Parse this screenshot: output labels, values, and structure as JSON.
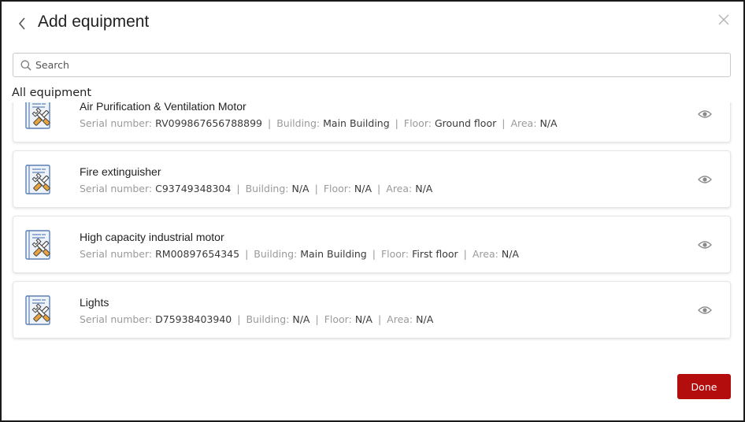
{
  "dialog": {
    "title": "Add equipment",
    "back_icon": "chevron-left-icon",
    "close_icon": "close-icon"
  },
  "search": {
    "placeholder": "Search",
    "value": "",
    "icon": "search-icon"
  },
  "section_label": "All equipment",
  "meta_labels": {
    "serial": "Serial number:",
    "building": "Building:",
    "floor": "Floor:",
    "area": "Area:",
    "separator": "|"
  },
  "equipment": [
    {
      "name": "Air Purification & Ventilation Motor",
      "serial": "RV099867656788899",
      "building": "Main Building",
      "floor": "Ground floor",
      "area": "N/A"
    },
    {
      "name": "Fire extinguisher",
      "serial": "C93749348304",
      "building": "N/A",
      "floor": "N/A",
      "area": "N/A"
    },
    {
      "name": "High capacity industrial motor",
      "serial": "RM00897654345",
      "building": "Main Building",
      "floor": "First floor",
      "area": "N/A"
    },
    {
      "name": "Lights",
      "serial": "D75938403940",
      "building": "N/A",
      "floor": "N/A",
      "area": "N/A"
    }
  ],
  "item_icon": "equipment-tools-icon",
  "view_icon": "eye-icon",
  "colors": {
    "accent": "#b30d0d",
    "icon_blue": "#5b7fb5",
    "icon_orange": "#e8a33c"
  },
  "done_label": "Done"
}
